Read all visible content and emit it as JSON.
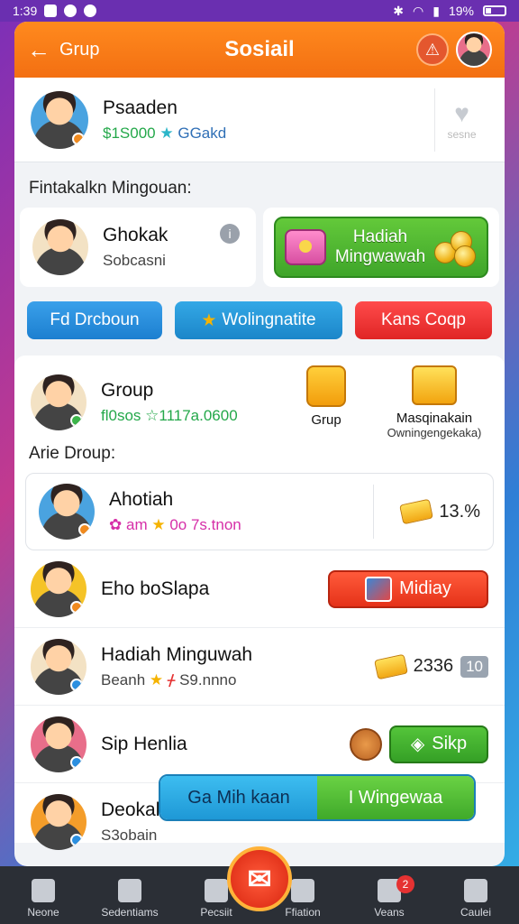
{
  "status": {
    "time": "1:39",
    "battery": "19%"
  },
  "header": {
    "back_label": "Grup",
    "title": "Sosiail"
  },
  "profile": {
    "name": "Psaaden",
    "amount": "$1S000",
    "badge": "GGakd",
    "fav_label": "sesne"
  },
  "weekly": {
    "section_label": "Fintakalkn Mingouan:",
    "user_name": "Ghokak",
    "user_sub": "Sobcasni",
    "reward_label": "Hadiah Mingwawah"
  },
  "tabs": [
    "Fd Drcboun",
    "Wolingnatite",
    "Kans Coqp"
  ],
  "group": {
    "name": "Group",
    "stats": "fl0sos ☆1117a.0600",
    "icon1_label": "Grup",
    "icon2_label": "Masqinakain",
    "icon2_sub": "Owningengekaka)"
  },
  "list_label": "Arie Droup:",
  "list": [
    {
      "name": "Ahotiah",
      "sub_a": "am",
      "sub_b": "0o 7s.tnon",
      "value": "13.%"
    },
    {
      "name": "Eho boSlapa",
      "button": "Midiay"
    },
    {
      "name": "Hadiah Minguwah",
      "sub_a": "Beanh",
      "sub_b": "S9.nnno",
      "value": "2336",
      "tag": "10"
    },
    {
      "name": "Sip Henlia",
      "button": "Sikp"
    },
    {
      "name": "Deokak",
      "sub_a": "S3obain"
    }
  ],
  "bottom_cta": {
    "left": "Ga Mih kaan",
    "right": "I Wingewaa"
  },
  "nav": [
    "Neone",
    "Sedentiams",
    "Pecsiit",
    "Ffiation",
    "Veans",
    "Caulei"
  ],
  "nav_badge": "2"
}
